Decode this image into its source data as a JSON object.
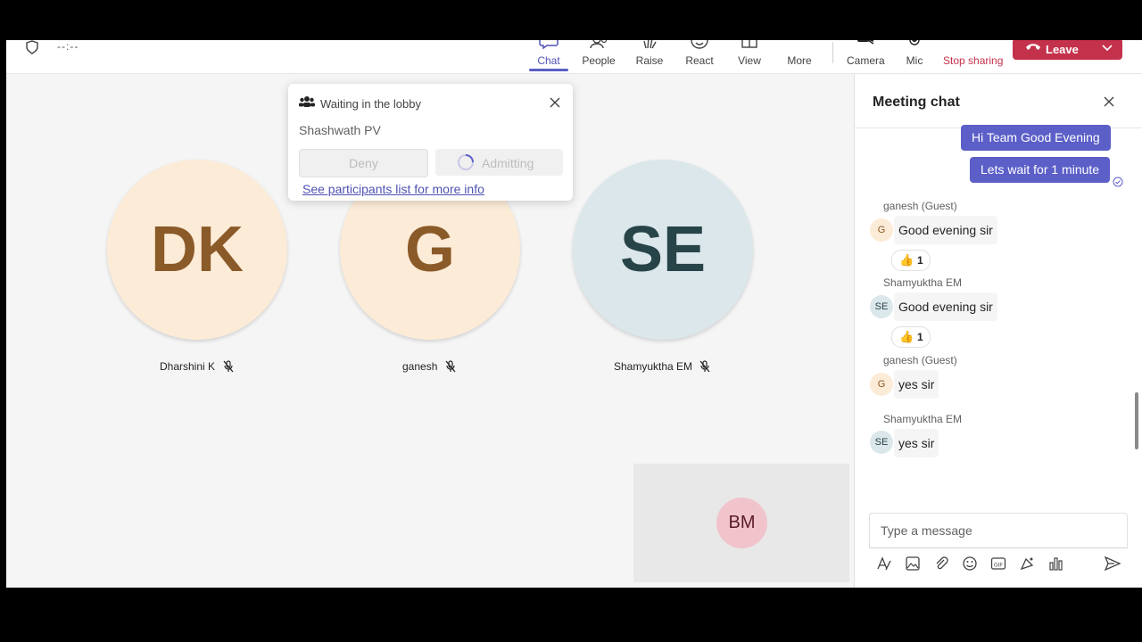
{
  "meeting": {
    "timer": "--:--",
    "toolbar": {
      "chat": "Chat",
      "people": "People",
      "raise": "Raise",
      "react": "React",
      "view": "View",
      "more": "More",
      "camera": "Camera",
      "mic": "Mic",
      "stop_sharing": "Stop sharing",
      "leave": "Leave"
    },
    "lobby": {
      "title": "Waiting in the lobby",
      "person": "Shashwath PV",
      "deny": "Deny",
      "admitting": "Admitting",
      "link": "See participants list for more info"
    },
    "participants": [
      {
        "initials": "DK",
        "name": "Dharshini K",
        "color": "#fcebd7"
      },
      {
        "initials": "G",
        "name": "ganesh",
        "color": "#fcebd7"
      },
      {
        "initials": "SE",
        "name": "Shamyuktha EM",
        "color": "#dbe7ea"
      }
    ],
    "self_view": {
      "initials": "BM"
    }
  },
  "chat": {
    "title": "Meeting chat",
    "my_messages": [
      "Hi Team Good Evening",
      "Lets wait for 1 minute"
    ],
    "messages": [
      {
        "sender": "ganesh (Guest)",
        "avatar": "G",
        "text": "Good evening sir",
        "reaction": "1"
      },
      {
        "sender": "Shamyuktha EM",
        "avatar": "SE",
        "text": "Good evening sir",
        "reaction": "1"
      },
      {
        "sender": "ganesh (Guest)",
        "avatar": "G",
        "text": "yes sir"
      },
      {
        "sender": "Shamyuktha EM",
        "avatar": "SE",
        "text": "yes sir"
      }
    ],
    "compose_placeholder": "Type a message"
  },
  "colors": {
    "accent": "#5b5fc7",
    "leave": "#c4314b"
  },
  "icons": [
    "shield-icon",
    "chat-icon",
    "people-icon",
    "raise-hand-icon",
    "react-icon",
    "view-icon",
    "more-icon",
    "camera-icon",
    "mic-icon",
    "stop-sharing-icon",
    "phone-icon",
    "close-icon",
    "mic-off-icon",
    "send-icon"
  ]
}
